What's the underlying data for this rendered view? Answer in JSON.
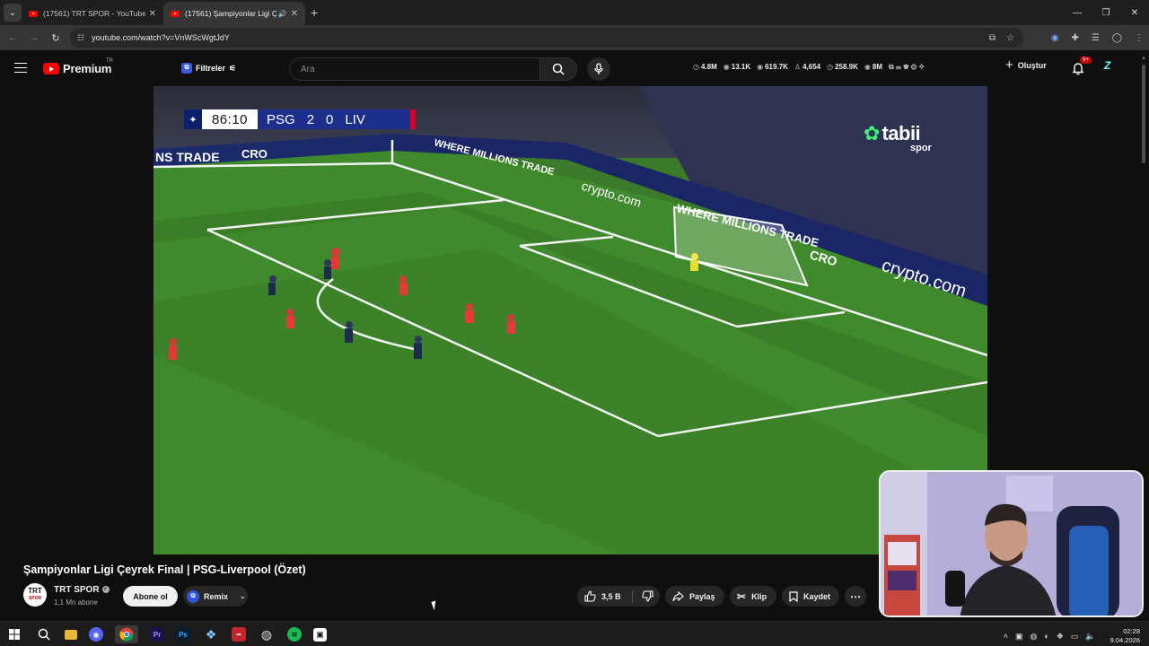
{
  "browser": {
    "tabs": [
      {
        "title": "(17561) TRT SPOR - YouTube",
        "active": false
      },
      {
        "title": "(17561) Şampiyonlar Ligi Ç",
        "active": true
      }
    ],
    "url": "youtube.com/watch?v=VnWScWgtJdY",
    "window_controls": {
      "minimize": "—",
      "restore": "❐",
      "close": "✕"
    }
  },
  "youtube": {
    "logo_text": "Premium",
    "country_code": "TR",
    "filters_label": "Filtreler",
    "search_placeholder": "Ara",
    "stats": [
      "4.8M",
      "13.1K",
      "619.7K",
      "4,654",
      "258.9K",
      "8M"
    ],
    "create_label": "Oluştur",
    "notif_badge": "9+"
  },
  "video": {
    "scoreboard": {
      "clock": "86:10",
      "home": "PSG",
      "home_score": "2",
      "away_score": "0",
      "away": "LIV"
    },
    "broadcaster": {
      "name": "tabii",
      "sub": "spor"
    },
    "ad_boards": [
      "NS TRADE",
      "CRO",
      "WHERE MILLIONS TRADE",
      "crypto.com",
      "WHERE MILLIONS TRADE",
      "CRO",
      "crypto.com"
    ],
    "title": "Şampiyonlar Ligi Çeyrek Final | PSG-Liverpool (Özet)"
  },
  "channel": {
    "name": "TRT SPOR",
    "avatar_text": "TRT",
    "avatar_sub": "SPOR",
    "subscribers": "1,1 Mn abone",
    "subscribe_label": "Abone ol",
    "remix_label": "Remix"
  },
  "actions": {
    "likes": "3,5 B",
    "share": "Paylaş",
    "clip": "Klip",
    "save": "Kaydet"
  },
  "taskbar": {
    "time": "02:28",
    "date": "9.04.2026"
  },
  "colors": {
    "yt_red": "#ff0000",
    "pitch_green": "#3b7a2a",
    "ucl_blue": "#1c2f8c",
    "liverpool_red": "#e0001b",
    "tabii_green": "#3ef07a"
  }
}
